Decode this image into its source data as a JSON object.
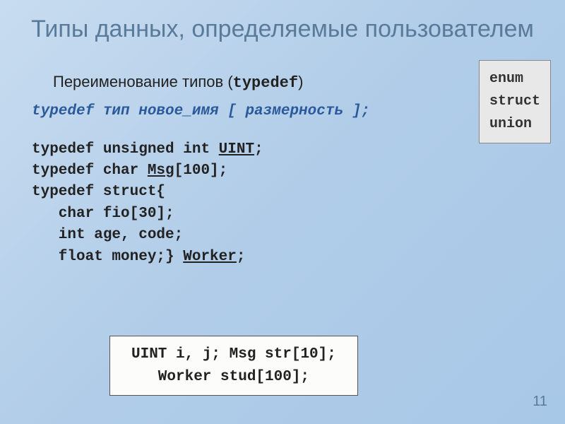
{
  "title": "Типы данных, определяемые пользователем",
  "sidebox": {
    "line1": "enum",
    "line2": "struct",
    "line3": "union"
  },
  "subtitle_prefix": "Переименование типов (",
  "subtitle_keyword": "typedef",
  "subtitle_suffix": ")",
  "syntax": "typedef тип новое_имя [ размерность ];",
  "code": {
    "l1a": "typedef unsigned int ",
    "l1b": "UINT",
    "l1c": ";",
    "l2a": "typedef char ",
    "l2b": "Msg",
    "l2c": "[100];",
    "l3": "typedef struct{",
    "l4": "   char fio[30];",
    "l5": "   int age, code;",
    "l6a": "   float money;} ",
    "l6b": "Worker",
    "l6c": ";"
  },
  "example": {
    "line1": "UINT i, j;  Msg str[10];",
    "line2": "Worker stud[100];"
  },
  "page_number": "11"
}
